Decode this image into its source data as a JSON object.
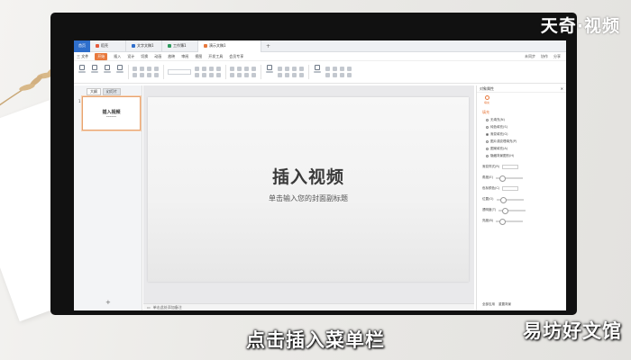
{
  "tabs": {
    "home": "首页",
    "items": [
      {
        "label": "稻壳",
        "color": "#e55a3c"
      },
      {
        "label": "文字文稿1",
        "color": "#2f6fcc"
      },
      {
        "label": "工作簿1",
        "color": "#2e9b5e"
      },
      {
        "label": "演示文稿1",
        "color": "#e8793d"
      }
    ],
    "add": "+"
  },
  "menu": {
    "file": "三 文件",
    "items": [
      "开始",
      "插入",
      "设计",
      "切换",
      "动画",
      "放映",
      "审阅",
      "视图",
      "开发工具",
      "会员专享"
    ],
    "right": [
      "未同步",
      "协作",
      "分享"
    ]
  },
  "left_panel": {
    "tabs": [
      "大纲",
      "幻灯片"
    ],
    "slide_number": "1",
    "thumb_title": "插入视频",
    "add": "+"
  },
  "slide": {
    "title": "插入视频",
    "subtitle": "单击输入您的封面副标题"
  },
  "notes_placeholder": "单击此处添加备注",
  "right_panel": {
    "title": "对象属性",
    "tab": "填充",
    "section": "填充",
    "options": [
      "无填充(N)",
      "纯色填充(S)",
      "渐变填充(G)",
      "图片或纹理填充(P)",
      "图案填充(A)",
      "隐藏背景图形(H)"
    ],
    "rows": [
      "渐变样式(R)",
      "角度(E)",
      "色标颜色(C)",
      "位置(O)",
      "透明度(T)",
      "亮度(B)"
    ],
    "footer": [
      "全部应用",
      "重置背景"
    ]
  },
  "caption": "点击插入菜单栏",
  "watermark_top": "天奇·视频",
  "watermark_bottom": "易坊好文馆"
}
